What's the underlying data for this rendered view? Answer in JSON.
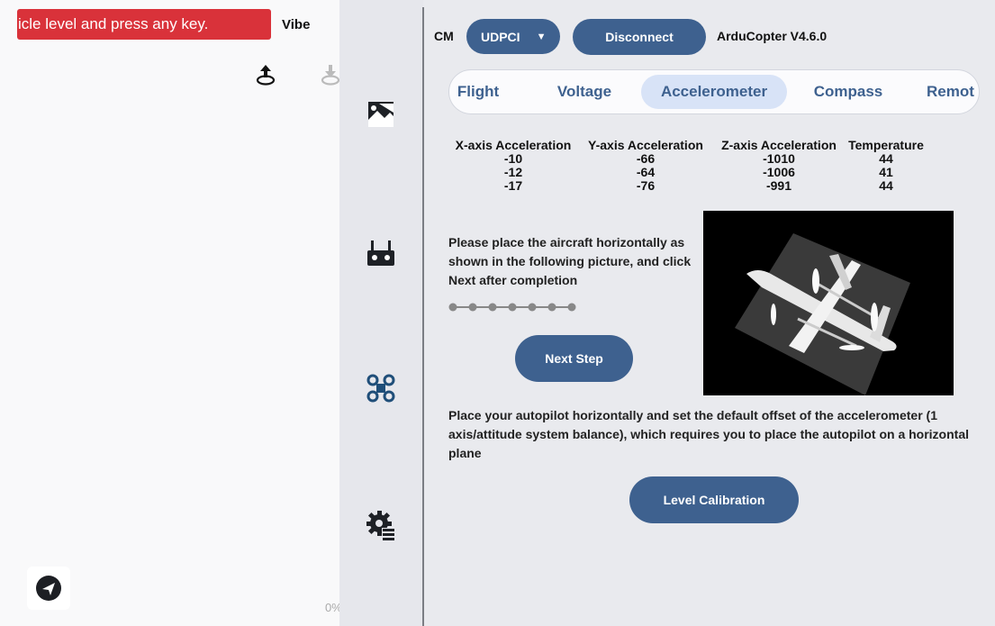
{
  "left_panel": {
    "status_banner": "icle level and press any key.",
    "vibe_label": "Vibe",
    "zoom_text": "0%",
    "icons": [
      "upload-icon",
      "download-icon",
      "send-icon"
    ]
  },
  "icon_rail": {
    "icons": [
      "photo-icon",
      "remote-controller-icon",
      "drone-icon",
      "settings-icon"
    ]
  },
  "header": {
    "cm_label": "CM",
    "connection_type": "UDPCI",
    "disconnect_label": "Disconnect",
    "firmware": "ArduCopter V4.6.0"
  },
  "tabs": [
    {
      "label": "Flight",
      "active": false
    },
    {
      "label": "Voltage",
      "active": false
    },
    {
      "label": "Accelerometer",
      "active": true
    },
    {
      "label": "Compass",
      "active": false
    },
    {
      "label": "Remot",
      "active": false
    }
  ],
  "accel_table": {
    "headers": [
      "X-axis Acceleration",
      "Y-axis Acceleration",
      "Z-axis Acceleration",
      "Temperature"
    ],
    "columns": [
      [
        "-10",
        "-12",
        "-17"
      ],
      [
        "-66",
        "-64",
        "-76"
      ],
      [
        "-1010",
        "-1006",
        "-991"
      ],
      [
        "44",
        "41",
        "44"
      ]
    ]
  },
  "instruction": "Please place the aircraft horizontally as shown in the following picture, and click Next after completion",
  "progress": {
    "steps": 7,
    "current": 0
  },
  "next_step_label": "Next Step",
  "level_description": "Place your autopilot horizontally and set the default offset of the accelerometer (1 axis/attitude system balance), which requires you to place the autopilot on a horizontal plane",
  "level_calibration_label": "Level Calibration",
  "colors": {
    "accent": "#3e618f",
    "banner": "#d9323a",
    "tab_active": "#d8e3f7"
  }
}
